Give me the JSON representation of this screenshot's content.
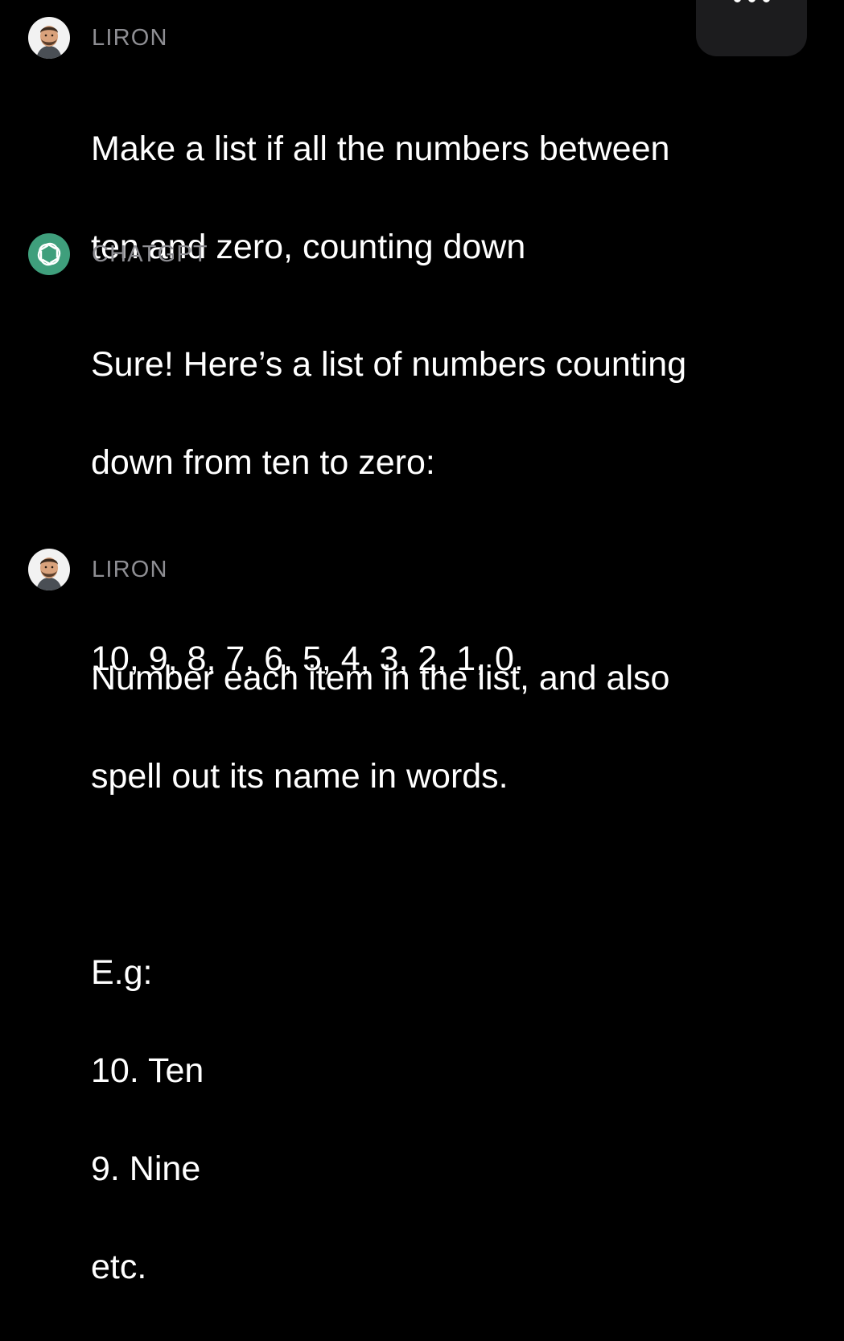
{
  "menu": {
    "icon": "ellipsis-icon"
  },
  "messages": [
    {
      "sender": "LIRON",
      "avatar": "user-photo",
      "paragraphs": [
        [
          "Make a list if all the numbers between",
          "ten and zero, counting down"
        ]
      ]
    },
    {
      "sender": "CHATGPT",
      "avatar": "openai-logo-icon",
      "paragraphs": [
        [
          "Sure! Here’s a list of numbers counting",
          "down from ten to zero:"
        ],
        [
          "10, 9, 8, 7, 6, 5, 4, 3, 2, 1, 0."
        ]
      ]
    },
    {
      "sender": "LIRON",
      "avatar": "user-photo",
      "paragraphs": [
        [
          "Number each item in the list, and also",
          "spell out its name in words."
        ],
        [
          "E.g:",
          "10. Ten",
          "9. Nine",
          "etc."
        ]
      ]
    }
  ],
  "colors": {
    "background": "#000000",
    "text": "#ffffff",
    "sender_label": "#8e8e93",
    "chatgpt_avatar": "#3f9f7c",
    "menu_button": "#1c1c1e"
  }
}
